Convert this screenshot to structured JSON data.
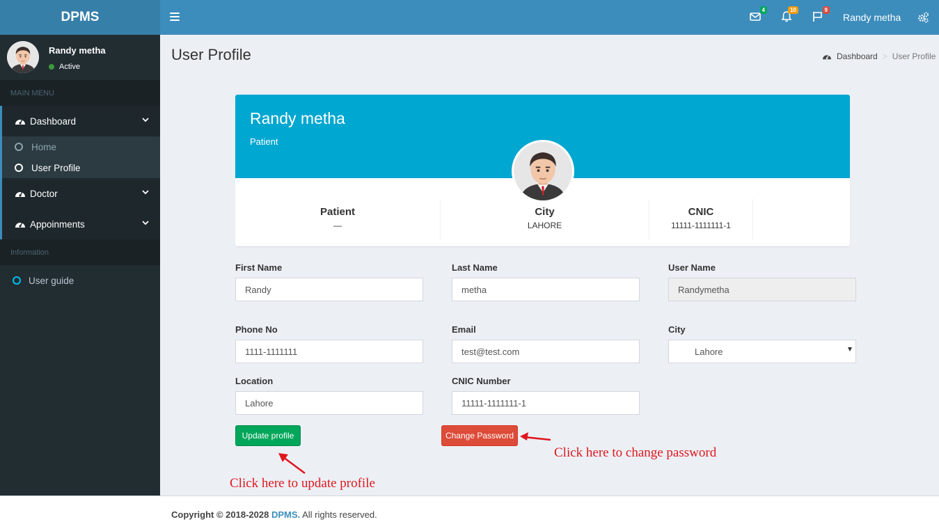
{
  "header": {
    "logo": "DPMS",
    "user_name": "Randy metha",
    "badges": {
      "mail": "4",
      "bell": "10",
      "flag": "9"
    },
    "badge_colors": {
      "mail": "#00a65a",
      "bell": "#f39c12",
      "flag": "#dd4b39"
    }
  },
  "sidebar": {
    "user": {
      "name": "Randy metha",
      "status": "Active"
    },
    "main_menu_header": "MAIN MENU",
    "dashboard": "Dashboard",
    "sub": {
      "home": "Home",
      "profile": "User Profile"
    },
    "doctor": "Doctor",
    "appointments": "Appoinments",
    "info_header": "Information",
    "guide": "User guide"
  },
  "page": {
    "title": "User Profile",
    "breadcrumb": {
      "home": "Dashboard",
      "current": "User Profile"
    }
  },
  "profile_card": {
    "name": "Randy metha",
    "role": "Patient",
    "stats": [
      {
        "title": "Patient",
        "value": "—"
      },
      {
        "title": "City",
        "value": "LAHORE"
      },
      {
        "title": "CNIC",
        "value": "11111-1111111-1"
      }
    ]
  },
  "form": {
    "first_name": {
      "label": "First Name",
      "value": "Randy"
    },
    "last_name": {
      "label": "Last Name",
      "value": "metha"
    },
    "user_name": {
      "label": "User Name",
      "value": "Randymetha"
    },
    "phone": {
      "label": "Phone No",
      "value": "1111-1111111"
    },
    "email": {
      "label": "Email",
      "value": "test@test.com"
    },
    "city": {
      "label": "City",
      "value": "Lahore"
    },
    "location": {
      "label": "Location",
      "value": "Lahore"
    },
    "cnic": {
      "label": "CNIC Number",
      "value": "11111-1111111-1"
    },
    "update_button": "Update profile",
    "change_password_button": "Change Password"
  },
  "annotations": {
    "password": "Click here to change password",
    "update": "Click here to update profile"
  },
  "footer": {
    "copyright": "Copyright © 2018-2028",
    "brand": "DPMS.",
    "rights": "All rights reserved."
  }
}
